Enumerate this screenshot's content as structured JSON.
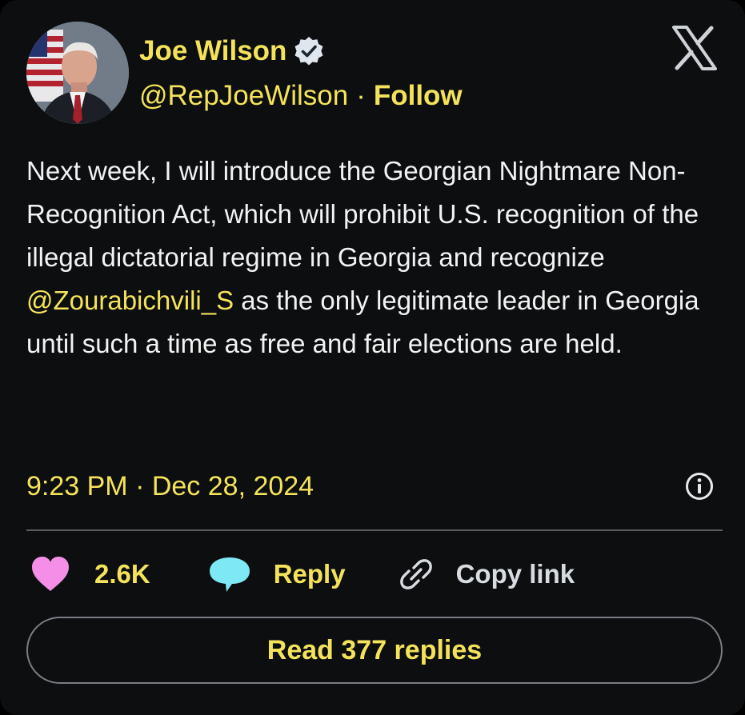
{
  "author": {
    "name": "Joe Wilson",
    "handle": "@RepJoeWilson",
    "separator": "·",
    "follow_label": "Follow",
    "verified_icon": "verified-badge-icon",
    "avatar_icon": "profile-photo"
  },
  "tweet": {
    "text_part1": "Next week, I will introduce the Georgian Nightmare Non-Recognition Act, which will prohibit U.S. recognition of the illegal dictatorial regime in Georgia and recognize ",
    "mention": "@Zourabichvili_S",
    "text_part2": " as the only legitimate leader in Georgia until such a time as free and fair elections are held.",
    "timestamp": "9:23 PM · Dec 28, 2024"
  },
  "actions": {
    "like_count": "2.6K",
    "reply_label": "Reply",
    "copy_label": "Copy link"
  },
  "read_replies_label": "Read 377 replies",
  "icons": {
    "logo": "x-logo-icon",
    "info": "info-icon",
    "like": "heart-icon",
    "reply": "speech-bubble-icon",
    "copy": "link-icon"
  },
  "colors": {
    "background": "#0c0e10",
    "accent_text": "#f4e35a",
    "body_text": "#f2f2f2",
    "heart": "#f58ee6",
    "reply_bubble": "#7ee8f5",
    "verified_badge": "#dfe6ee"
  }
}
